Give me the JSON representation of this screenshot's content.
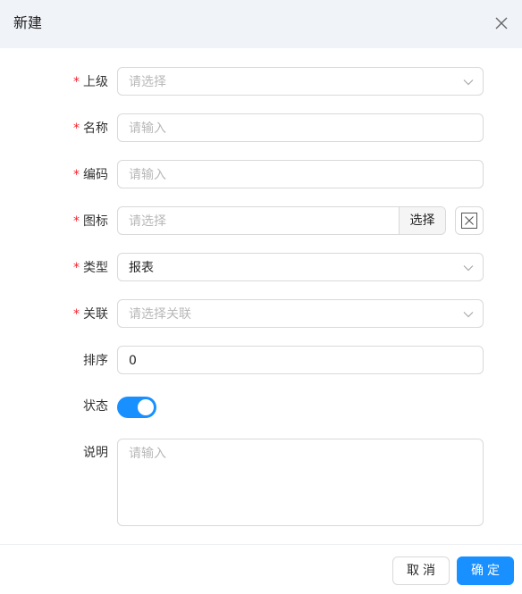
{
  "dialog": {
    "title": "新建"
  },
  "form": {
    "required_mark": "*",
    "parent": {
      "label": "上级",
      "placeholder": "请选择",
      "value": ""
    },
    "name": {
      "label": "名称",
      "placeholder": "请输入",
      "value": ""
    },
    "code": {
      "label": "编码",
      "placeholder": "请输入",
      "value": ""
    },
    "icon": {
      "label": "图标",
      "placeholder": "请选择",
      "value": "",
      "select_button": "选择"
    },
    "type": {
      "label": "类型",
      "value": "报表"
    },
    "relation": {
      "label": "关联",
      "placeholder": "请选择关联",
      "value": ""
    },
    "sort": {
      "label": "排序",
      "value": "0"
    },
    "status": {
      "label": "状态",
      "enabled": true
    },
    "description": {
      "label": "说明",
      "placeholder": "请输入",
      "value": ""
    }
  },
  "footer": {
    "cancel_label": "取消",
    "ok_label": "确定"
  },
  "colors": {
    "primary": "#1890ff",
    "required": "#f5222d",
    "header_bg": "#f0f3f8"
  }
}
